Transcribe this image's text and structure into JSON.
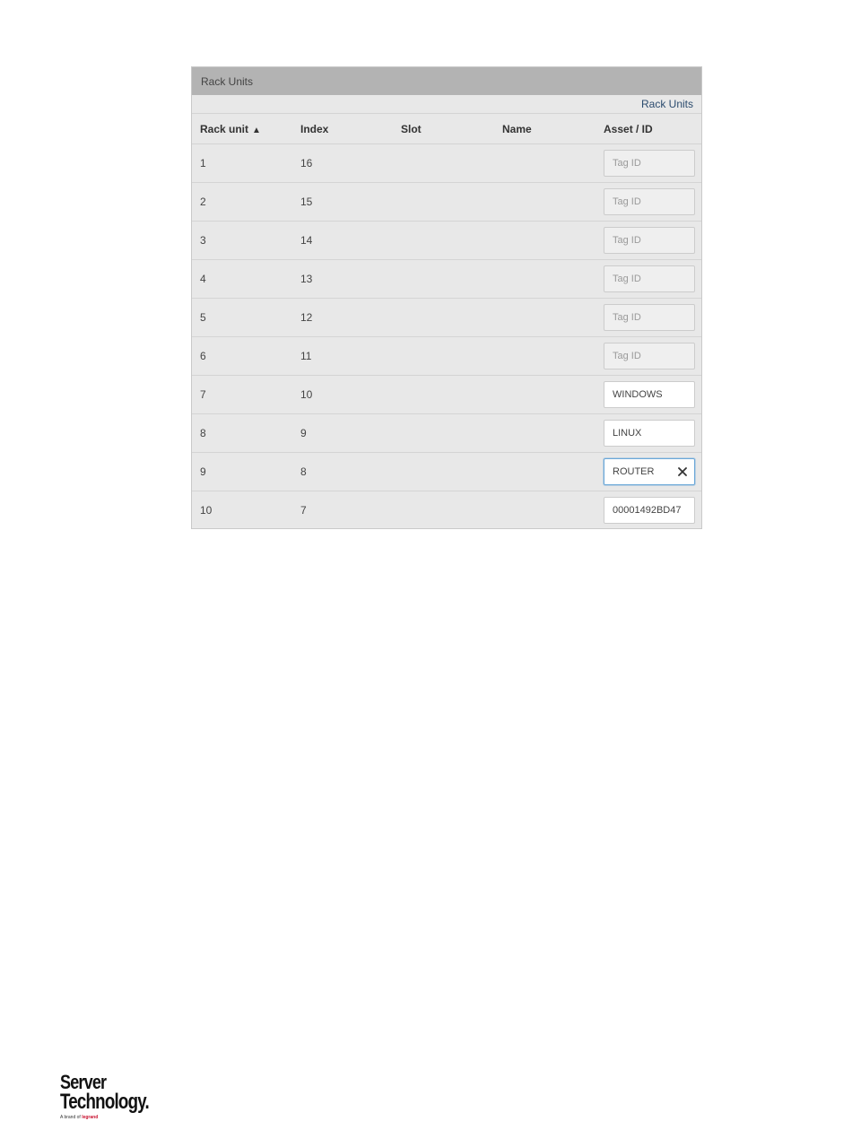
{
  "panel": {
    "title": "Rack Units",
    "toolbar_link": "Rack Units"
  },
  "table": {
    "columns": {
      "rack_unit": "Rack unit",
      "sort_indicator": "▲",
      "index": "Index",
      "slot": "Slot",
      "name": "Name",
      "asset_id": "Asset / ID"
    },
    "rows": [
      {
        "rack_unit": "1",
        "index": "16",
        "slot": "",
        "name": "",
        "asset_value": "",
        "asset_placeholder": "Tag ID"
      },
      {
        "rack_unit": "2",
        "index": "15",
        "slot": "",
        "name": "",
        "asset_value": "",
        "asset_placeholder": "Tag ID"
      },
      {
        "rack_unit": "3",
        "index": "14",
        "slot": "",
        "name": "",
        "asset_value": "",
        "asset_placeholder": "Tag ID"
      },
      {
        "rack_unit": "4",
        "index": "13",
        "slot": "",
        "name": "",
        "asset_value": "",
        "asset_placeholder": "Tag ID"
      },
      {
        "rack_unit": "5",
        "index": "12",
        "slot": "",
        "name": "",
        "asset_value": "",
        "asset_placeholder": "Tag ID"
      },
      {
        "rack_unit": "6",
        "index": "11",
        "slot": "",
        "name": "",
        "asset_value": "",
        "asset_placeholder": "Tag ID"
      },
      {
        "rack_unit": "7",
        "index": "10",
        "slot": "",
        "name": "",
        "asset_value": "WINDOWS",
        "asset_placeholder": ""
      },
      {
        "rack_unit": "8",
        "index": "9",
        "slot": "",
        "name": "",
        "asset_value": "LINUX",
        "asset_placeholder": ""
      },
      {
        "rack_unit": "9",
        "index": "8",
        "slot": "",
        "name": "",
        "asset_value": "ROUTER",
        "asset_placeholder": ""
      },
      {
        "rack_unit": "10",
        "index": "7",
        "slot": "",
        "name": "",
        "asset_value": "00001492BD47",
        "asset_placeholder": ""
      }
    ]
  },
  "logo": {
    "line1": "Server",
    "line2": "Technology",
    "tagline_prefix": "A brand of ",
    "tagline_brand": "legrand"
  },
  "colors": {
    "header_bg": "#b3b3b3",
    "panel_bg": "#e8e8e8",
    "link": "#2b4b6e",
    "focus_border": "#6aa7d8",
    "brand_red": "#c8102e"
  },
  "icons": {
    "clear": "close-icon",
    "sort": "sort-ascending-icon"
  }
}
